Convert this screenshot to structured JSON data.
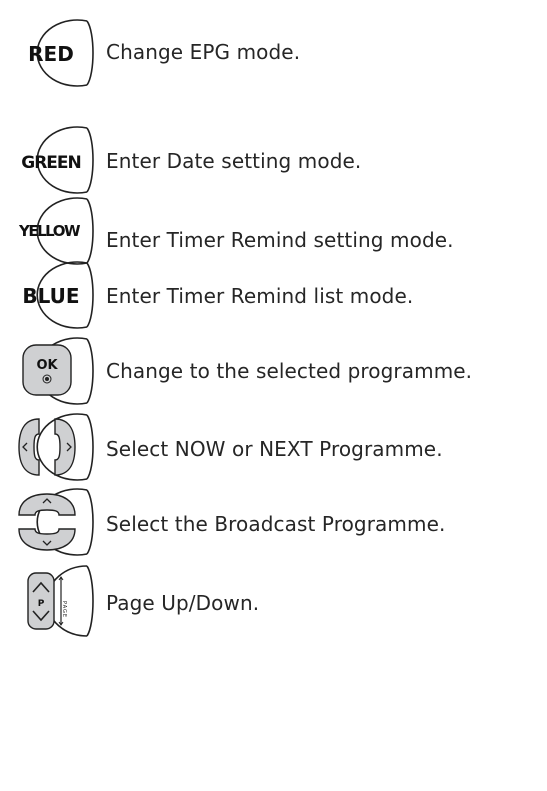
{
  "rows": [
    {
      "key": "RED",
      "text": "Change EPG mode."
    },
    {
      "key": "GREEN",
      "text": "Enter Date setting mode."
    },
    {
      "key": "YELLOW",
      "text": "Enter Timer Remind setting mode."
    },
    {
      "key": "BLUE",
      "text": "Enter Timer Remind list mode."
    },
    {
      "key": "OK",
      "text": "Change to the selected programme."
    },
    {
      "key": "",
      "text": "Select NOW or NEXT Programme."
    },
    {
      "key": "",
      "text": "Select the Broadcast Programme."
    },
    {
      "key": "P",
      "sub": "PAGE",
      "text": "Page Up/Down."
    }
  ]
}
